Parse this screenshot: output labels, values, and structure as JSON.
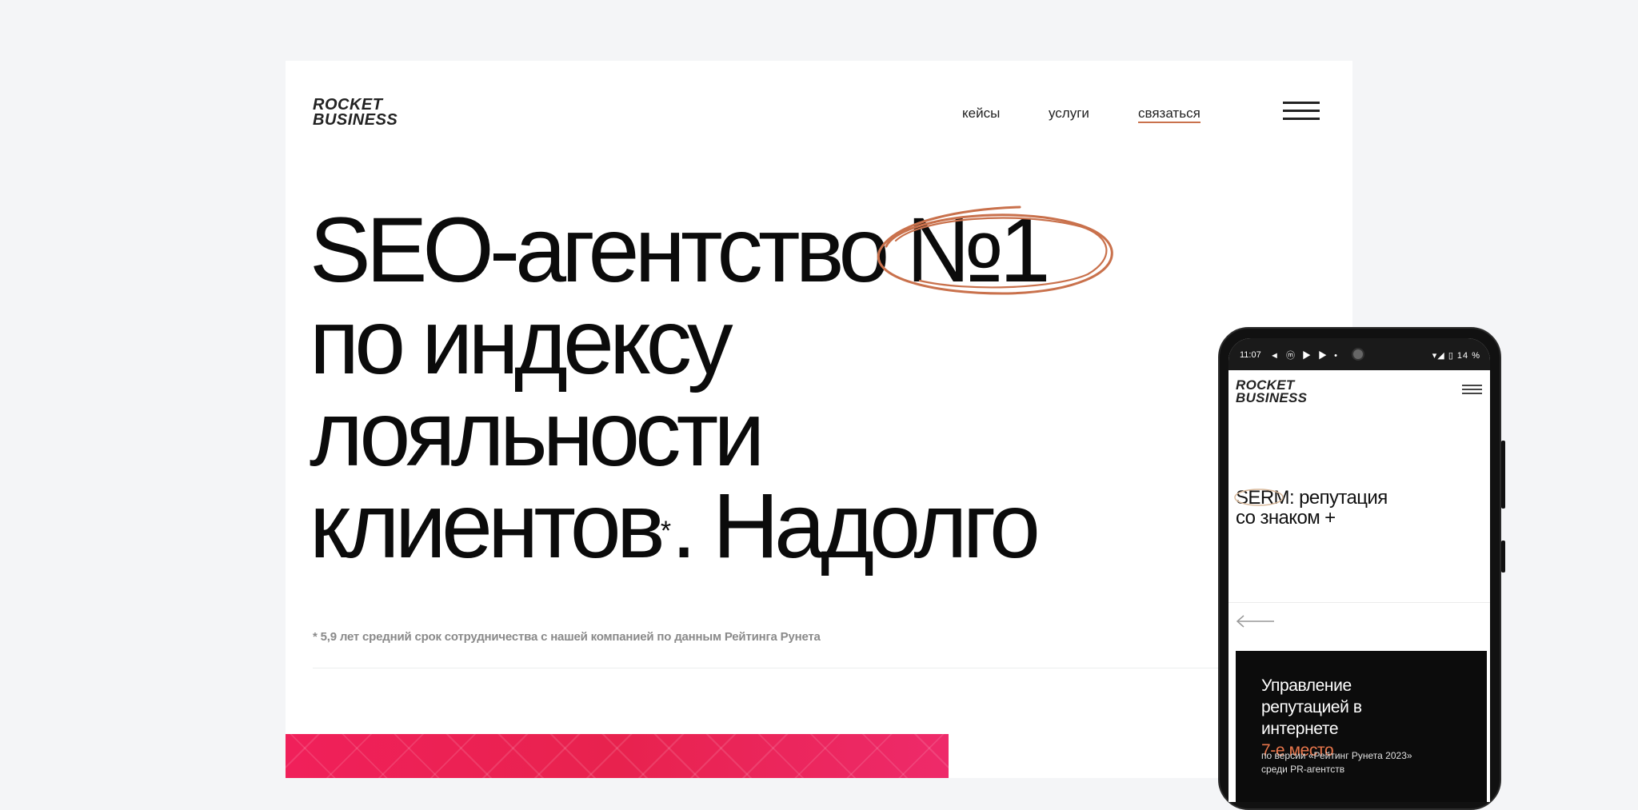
{
  "brand": {
    "line1": "ROCKET",
    "line2": "BUSINESS"
  },
  "nav": {
    "cases": "кейсы",
    "services": "услуги",
    "contact": "связаться"
  },
  "hero": {
    "line1": "SEO-агентство №1",
    "line2": "по индексу",
    "line3": "лояльности",
    "line4_a": "клиентов",
    "line4_star": "*",
    "line4_b": ". Надолго",
    "footnote": "* 5,9 лет средний срок сотрудничества с нашей компанией по данным Рейтинга Рунета"
  },
  "phone": {
    "status": {
      "time": "11:07",
      "icons": "◄ ⓜ ▶ ▶ •",
      "right": "▾◢ ▯ 14 %"
    },
    "brand": {
      "line1": "ROCKET",
      "line2": "BUSINESS"
    },
    "title": {
      "line1": "SERM: репутация",
      "line2": "со знаком +"
    },
    "card": {
      "line1": "Управление",
      "line2": "репутацией в",
      "line3_a": "интернете ",
      "line3_accent": "7-е место",
      "sub1": "по версии «Рейтинг Рунета 2023»",
      "sub2": "среди PR-агентств"
    }
  },
  "colors": {
    "accent": "#c9714c",
    "mobile_accent": "#e8764b",
    "banner": "#ee2258",
    "background": "#f4f5f7"
  },
  "icons": {
    "menu": "hamburger-menu-icon",
    "arrow": "arrow-left-icon",
    "highlight": "scribble-circle-icon"
  }
}
